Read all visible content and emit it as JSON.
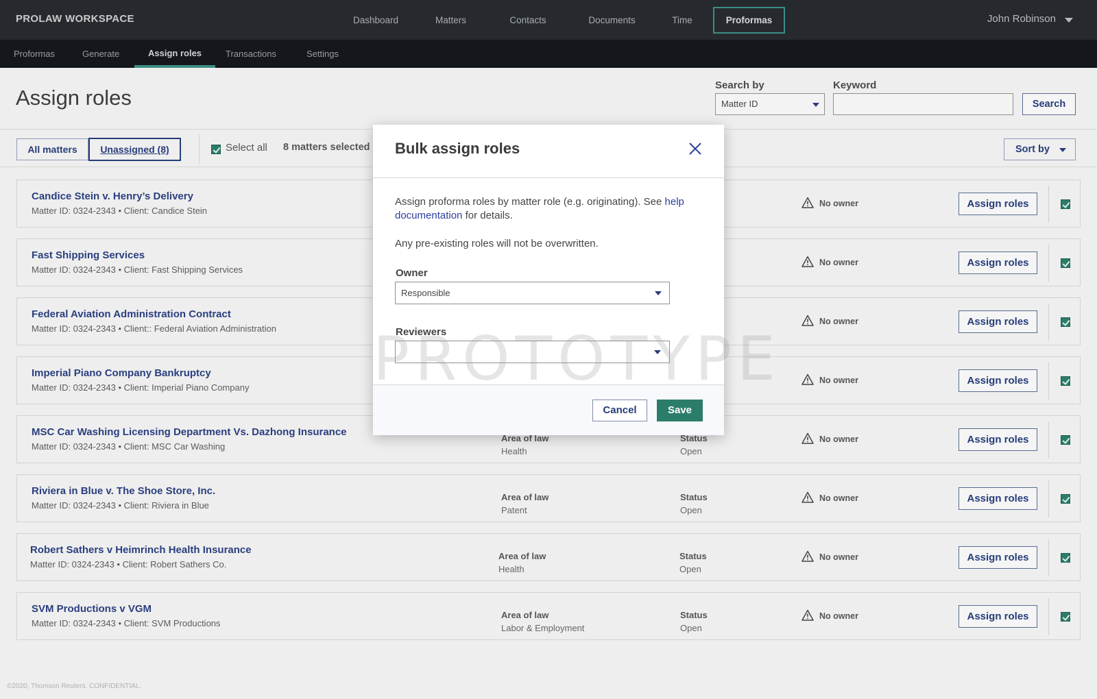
{
  "brand": "PROLAW WORKSPACE",
  "topnav": [
    {
      "label": "Dashboard"
    },
    {
      "label": "Matters"
    },
    {
      "label": "Contacts"
    },
    {
      "label": "Documents"
    },
    {
      "label": "Time"
    },
    {
      "label": "Proformas",
      "active": true
    }
  ],
  "user": {
    "name": "John Robinson"
  },
  "subnav": [
    {
      "label": "Proformas"
    },
    {
      "label": "Generate"
    },
    {
      "label": "Assign roles",
      "active": true
    },
    {
      "label": "Transactions"
    },
    {
      "label": "Settings"
    }
  ],
  "page": {
    "title": "Assign roles"
  },
  "search": {
    "search_by_label": "Search by",
    "search_by_value": "Matter ID",
    "keyword_label": "Keyword",
    "keyword_value": "",
    "button": "Search"
  },
  "filters": {
    "all_label": "All matters",
    "unassigned_label": "Unassigned (8)",
    "select_all_label": "Select all",
    "selected_count": "8 matters selected",
    "sort_label": "Sort by"
  },
  "row_labels": {
    "area_label": "Area of law",
    "status_label": "Status",
    "no_owner": "No owner",
    "assign_button": "Assign roles"
  },
  "matters": [
    {
      "title": "Candice Stein v. Henry’s Delivery",
      "matter_id": "Matter ID: 0324-2343",
      "client": "Client: Candice Stein",
      "area": "",
      "status": ""
    },
    {
      "title": "Fast Shipping Services",
      "matter_id": "Matter ID: 0324-2343",
      "client": "Client: Fast Shipping Services",
      "area": "",
      "status": ""
    },
    {
      "title": "Federal Aviation Administration Contract",
      "matter_id": "Matter ID: 0324-2343",
      "client": "Client:: Federal Aviation Administration",
      "area": "",
      "status": ""
    },
    {
      "title": "Imperial Piano Company Bankruptcy",
      "matter_id": "Matter ID: 0324-2343",
      "client": "Client: Imperial Piano Company",
      "area": "",
      "status": ""
    },
    {
      "title": "MSC Car Washing Licensing Department Vs. Dazhong Insurance",
      "matter_id": "Matter ID: 0324-2343",
      "client": "Client: MSC Car Washing",
      "area": "Health",
      "status": "Open"
    },
    {
      "title": "Riviera in Blue v. The Shoe Store, Inc.",
      "matter_id": "Matter ID: 0324-2343",
      "client": "Client: Riviera in Blue",
      "area": "Patent",
      "status": "Open"
    },
    {
      "title": "Robert Sathers v Heimrinch Health Insurance",
      "matter_id": "Matter ID: 0324-2343",
      "client": "Client: Robert Sathers Co.",
      "area": "Health",
      "status": "Open"
    },
    {
      "title": "SVM Productions v VGM",
      "matter_id": "Matter ID: 0324-2343",
      "client": "Client: SVM Productions",
      "area": "Labor & Employment",
      "status": "Open"
    }
  ],
  "footer": "©2020, Thomson Reuters. CONFIDENTIAL.",
  "modal": {
    "title": "Bulk assign roles",
    "text_before_link": "Assign proforma roles by matter role (e.g. originating). See ",
    "link_text": "help documentation",
    "text_after_link": " for details.",
    "note": "Any pre-existing roles will not be overwritten.",
    "owner_label": "Owner",
    "owner_value": "Responsible",
    "reviewers_label": "Reviewers",
    "reviewers_value": "",
    "watermark": "PROTOTYPE",
    "cancel": "Cancel",
    "save": "Save"
  },
  "colors": {
    "accent": "#2c7c6a",
    "link": "#2a3f7f",
    "topbar": "#262a2f",
    "subbar": "#14171b"
  }
}
